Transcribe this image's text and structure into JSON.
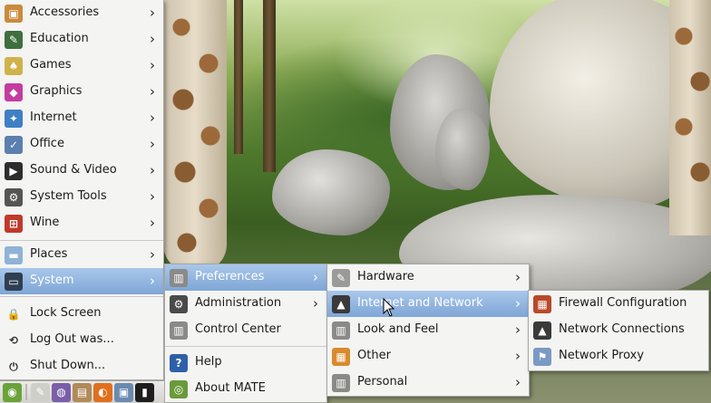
{
  "main_menu": {
    "items": [
      {
        "label": "Accessories",
        "icon": "accessories-icon",
        "color": "#c98a3c",
        "glyph": "▣"
      },
      {
        "label": "Education",
        "icon": "education-icon",
        "color": "#3f6e3f",
        "glyph": "✎"
      },
      {
        "label": "Games",
        "icon": "games-icon",
        "color": "#d0b24a",
        "glyph": "♠"
      },
      {
        "label": "Graphics",
        "icon": "graphics-icon",
        "color": "#c43ca0",
        "glyph": "◆"
      },
      {
        "label": "Internet",
        "icon": "internet-icon",
        "color": "#3f7fc4",
        "glyph": "✦"
      },
      {
        "label": "Office",
        "icon": "office-icon",
        "color": "#5b7fae",
        "glyph": "✓"
      },
      {
        "label": "Sound & Video",
        "icon": "sound-video-icon",
        "color": "#2d2d2d",
        "glyph": "▶"
      },
      {
        "label": "System Tools",
        "icon": "system-tools-icon",
        "color": "#555555",
        "glyph": "⚙"
      },
      {
        "label": "Wine",
        "icon": "wine-icon",
        "color": "#c0392b",
        "glyph": "⊞"
      }
    ],
    "places": {
      "label": "Places",
      "icon": "places-folder-icon",
      "color": "#8fb2d6",
      "glyph": "▬"
    },
    "system": {
      "label": "System",
      "icon": "system-monitor-icon",
      "color": "#2f3e52",
      "glyph": "▭"
    },
    "lock": {
      "label": "Lock Screen",
      "icon": "lock-icon",
      "glyph": "🔒"
    },
    "logout": {
      "label": "Log Out was...",
      "icon": "logout-icon",
      "glyph": "⟲"
    },
    "shutdown": {
      "label": "Shut Down...",
      "icon": "power-icon",
      "glyph": "⏻"
    }
  },
  "system_menu": {
    "preferences": {
      "label": "Preferences",
      "icon": "preferences-icon",
      "color": "#8a8a88",
      "glyph": "▥"
    },
    "administration": {
      "label": "Administration",
      "icon": "administration-icon",
      "color": "#4a4a4a",
      "glyph": "⚙"
    },
    "control_center": {
      "label": "Control Center",
      "icon": "control-center-icon",
      "color": "#8a8a88",
      "glyph": "▥"
    },
    "help": {
      "label": "Help",
      "icon": "help-icon",
      "color": "#2f5fa8",
      "glyph": "?"
    },
    "about": {
      "label": "About MATE",
      "icon": "mate-logo-icon",
      "color": "#6a9a3a",
      "glyph": "◎"
    }
  },
  "prefs_menu": {
    "items": [
      {
        "label": "Hardware",
        "icon": "hardware-icon",
        "color": "#9a9a98",
        "glyph": "✎"
      },
      {
        "label": "Internet and Network",
        "icon": "network-icon",
        "color": "#3a3a3a",
        "glyph": "▲"
      },
      {
        "label": "Look and Feel",
        "icon": "look-feel-icon",
        "color": "#8a8a88",
        "glyph": "▥"
      },
      {
        "label": "Other",
        "icon": "other-icon",
        "color": "#d98a2c",
        "glyph": "▦"
      },
      {
        "label": "Personal",
        "icon": "personal-icon",
        "color": "#8a8a88",
        "glyph": "▥"
      }
    ]
  },
  "net_menu": {
    "items": [
      {
        "label": "Firewall Configuration",
        "icon": "firewall-icon",
        "color": "#b8492a",
        "glyph": "▦"
      },
      {
        "label": "Network Connections",
        "icon": "network-connections-icon",
        "color": "#3a3a3a",
        "glyph": "▲"
      },
      {
        "label": "Network Proxy",
        "icon": "network-proxy-icon",
        "color": "#7a9ac4",
        "glyph": "⚑"
      }
    ]
  },
  "panel": {
    "icons": [
      {
        "name": "mate-menu-icon",
        "color": "#6aa33a",
        "glyph": "◉"
      },
      {
        "name": "text-editor-icon",
        "color": "#cfcfca",
        "glyph": "✎"
      },
      {
        "name": "pidgin-icon",
        "color": "#7a5ea8",
        "glyph": "◍"
      },
      {
        "name": "archive-icon",
        "color": "#b08a5a",
        "glyph": "▤"
      },
      {
        "name": "firefox-icon",
        "color": "#e0701e",
        "glyph": "◐"
      },
      {
        "name": "file-manager-icon",
        "color": "#6a8ab0",
        "glyph": "▣"
      },
      {
        "name": "terminal-icon",
        "color": "#1e1e1e",
        "glyph": "▮"
      }
    ]
  }
}
